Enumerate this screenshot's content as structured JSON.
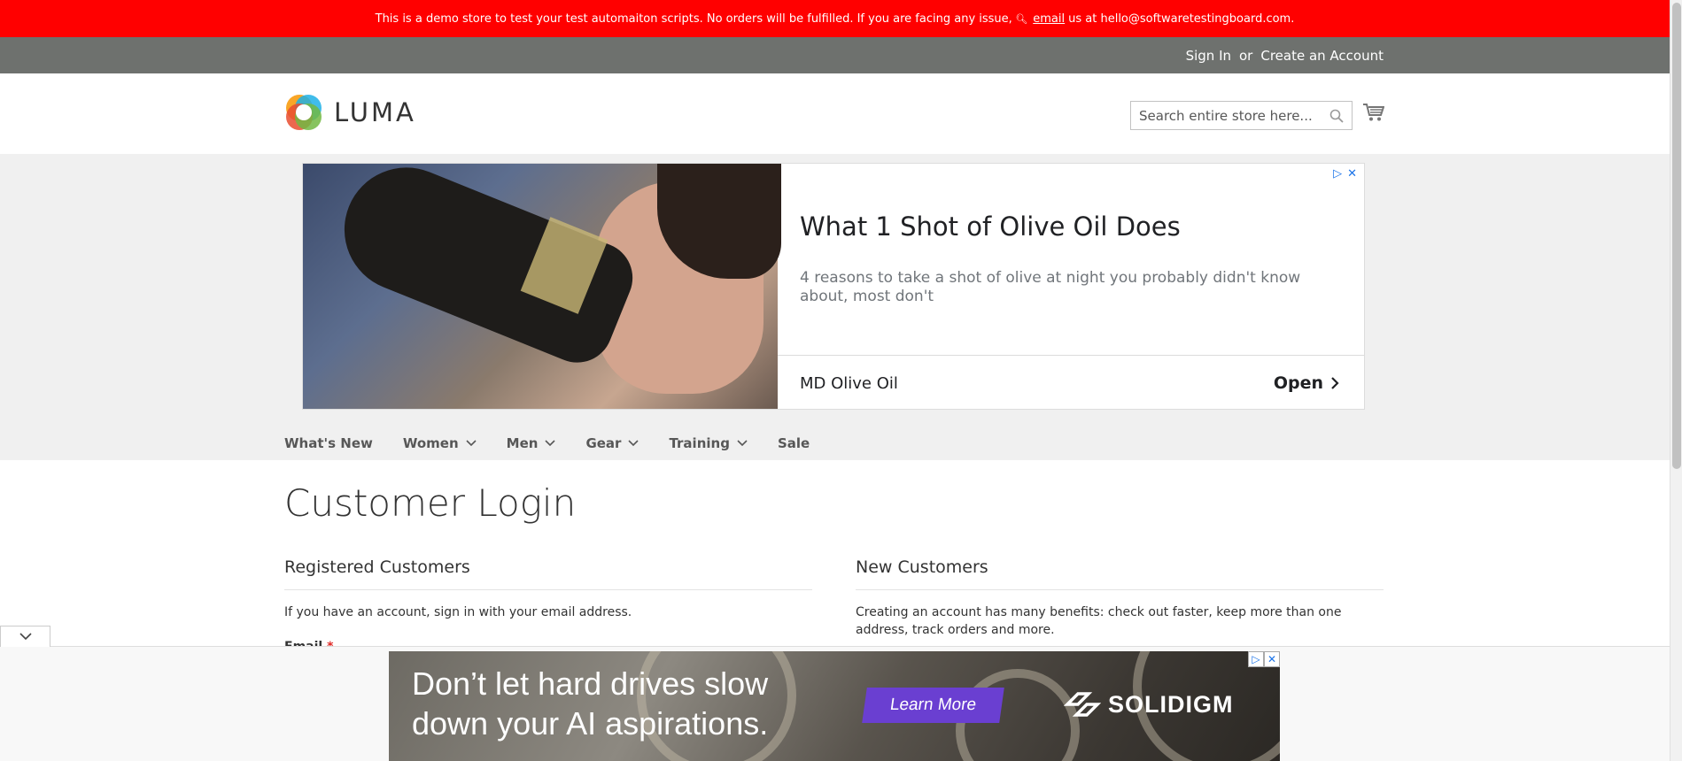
{
  "demo_banner": {
    "text_before": "This is a demo store to test your test automaiton scripts. No orders will be fulfilled. If you are facing any issue,",
    "email_link": "email",
    "text_after": "us at hello@softwaretestingboard.com."
  },
  "header_links": {
    "sign_in": "Sign In",
    "or": "or",
    "create_account": "Create an Account"
  },
  "logo": {
    "text": "LUMA"
  },
  "search": {
    "placeholder": "Search entire store here..."
  },
  "ad": {
    "headline": "What 1 Shot of Olive Oil Does",
    "body": "4 reasons to take a shot of olive at night you probably didn't know about, most don't",
    "advertiser": "MD Olive Oil",
    "cta": "Open"
  },
  "nav": {
    "items": [
      {
        "label": "What's New",
        "has_dropdown": false
      },
      {
        "label": "Women",
        "has_dropdown": true
      },
      {
        "label": "Men",
        "has_dropdown": true
      },
      {
        "label": "Gear",
        "has_dropdown": true
      },
      {
        "label": "Training",
        "has_dropdown": true
      },
      {
        "label": "Sale",
        "has_dropdown": false
      }
    ]
  },
  "main": {
    "page_title": "Customer Login",
    "registered": {
      "title": "Registered Customers",
      "text": "If you have an account, sign in with your email address.",
      "email_label": "Email",
      "required_mark": "*"
    },
    "new_customers": {
      "title": "New Customers",
      "text": "Creating an account has many benefits: check out faster, keep more than one address, track orders and more."
    }
  },
  "bottom_ad": {
    "line1": "Don’t let hard drives slow",
    "line2": "down your AI aspirations.",
    "cta": "Learn More",
    "brand": "SOLIDIGM"
  },
  "colors": {
    "banner": "#ff0000",
    "header_panel": "#6e716e",
    "ad_cta": "#6a3fd1",
    "required": "#e02b27"
  }
}
